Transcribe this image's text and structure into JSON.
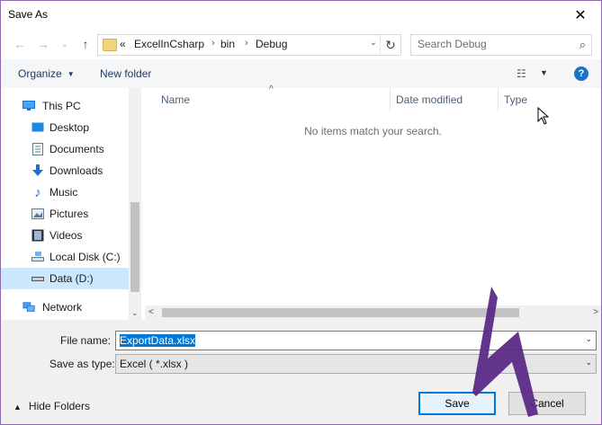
{
  "window": {
    "title": "Save As",
    "close_glyph": "✕"
  },
  "nav": {
    "back_glyph": "←",
    "forward_glyph": "→",
    "recent_glyph": "⌄",
    "up_glyph": "↑"
  },
  "address": {
    "prefix": "«",
    "crumbs": [
      "ExcelInCsharp",
      "bin",
      "Debug"
    ],
    "sep_glyph": "›",
    "dropdown_glyph": "⌄",
    "refresh_glyph": "↻"
  },
  "search": {
    "placeholder": "Search Debug",
    "icon_glyph": "⌕"
  },
  "toolbar": {
    "organize": "Organize",
    "organize_caret": "▼",
    "new_folder": "New folder",
    "view_glyph": "☷",
    "view_caret": "▼",
    "help_glyph": "?"
  },
  "sidebar": {
    "items": [
      {
        "label": "This PC",
        "icon": "pc-icon",
        "glyph": "▭",
        "color": "#1e88e5"
      },
      {
        "label": "Desktop",
        "icon": "desktop-icon",
        "glyph": "▬",
        "color": "#1e88e5"
      },
      {
        "label": "Documents",
        "icon": "documents-icon",
        "glyph": "▤",
        "color": "#607d8b"
      },
      {
        "label": "Downloads",
        "icon": "downloads-icon",
        "glyph": "⬇",
        "color": "#1e6fd6"
      },
      {
        "label": "Music",
        "icon": "music-icon",
        "glyph": "♪",
        "color": "#1e6fd6"
      },
      {
        "label": "Pictures",
        "icon": "pictures-icon",
        "glyph": "▨",
        "color": "#5c7a99"
      },
      {
        "label": "Videos",
        "icon": "videos-icon",
        "glyph": "▦",
        "color": "#444444"
      },
      {
        "label": "Local Disk (C:)",
        "icon": "local-disk-icon",
        "glyph": "▭",
        "color": "#607d8b"
      },
      {
        "label": "Data (D:)",
        "icon": "drive-icon",
        "glyph": "▬",
        "color": "#555555"
      },
      {
        "label": "Network",
        "icon": "network-icon",
        "glyph": "▣",
        "color": "#1e88e5"
      }
    ],
    "scroll_glyph": "⌄"
  },
  "files": {
    "columns": [
      "Name",
      "Date modified",
      "Type"
    ],
    "sort_glyph": "^",
    "empty_message": "No items match your search.",
    "left_glyph": "<",
    "right_glyph": ">"
  },
  "form": {
    "filename_label": "File name:",
    "filename_value": "ExportData.xlsx",
    "savetype_label": "Save as type:",
    "savetype_value": "Excel  ( *.xlsx )",
    "dropdown_glyph": "⌄"
  },
  "footer": {
    "hide_folders": "Hide Folders",
    "hide_caret": "▲",
    "save": "Save",
    "cancel": "Cancel"
  },
  "colors": {
    "accent": "#0078d7",
    "annotation": "#5b2a86",
    "selection": "#cce8ff"
  }
}
